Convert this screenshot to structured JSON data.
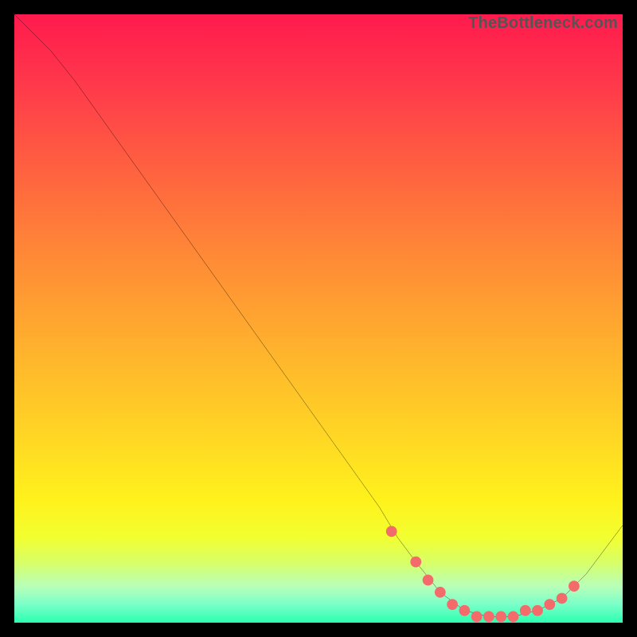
{
  "watermark": "TheBottleneck.com",
  "colors": {
    "line": "#000000",
    "marker": "#f36b6b",
    "frame_bg": "#000000"
  },
  "chart_data": {
    "type": "line",
    "title": "",
    "xlabel": "",
    "ylabel": "",
    "xlim": [
      0,
      100
    ],
    "ylim": [
      0,
      100
    ],
    "series": [
      {
        "name": "curve",
        "x": [
          0,
          6,
          10,
          15,
          20,
          25,
          30,
          35,
          40,
          45,
          50,
          55,
          60,
          63,
          66,
          70,
          74,
          78,
          82,
          86,
          90,
          94,
          100
        ],
        "y": [
          100,
          94,
          89,
          82,
          75,
          68,
          61,
          54,
          47,
          40,
          33,
          26,
          19,
          14,
          10,
          5,
          2,
          1,
          1,
          2,
          4,
          8,
          16
        ]
      }
    ],
    "markers": {
      "name": "highlight-points",
      "x": [
        62,
        66,
        68,
        70,
        72,
        74,
        76,
        78,
        80,
        82,
        84,
        86,
        88,
        90,
        92
      ],
      "y": [
        15,
        10,
        7,
        5,
        3,
        2,
        1,
        1,
        1,
        1,
        2,
        2,
        3,
        4,
        6
      ]
    }
  }
}
